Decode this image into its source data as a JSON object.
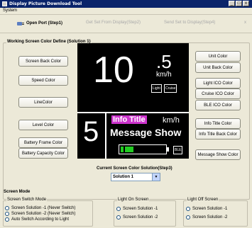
{
  "window": {
    "title": "Display Picture Download Tool",
    "buttons": [
      "_",
      "□",
      "x"
    ]
  },
  "menu": {
    "items": [
      "System"
    ]
  },
  "toolbar": {
    "open_port": "Open Port (Step1)",
    "get_set": "Get Set From Display(Step2)",
    "send_set": "Send Set to Display(Step4)",
    "close": "x"
  },
  "working": {
    "title": "Working Screen Color Define (Solution 1)",
    "left_buttons": [
      "Screen Back Color",
      "Speed Color",
      "LineColor",
      "Level Color",
      "Battery Frame Color",
      "Battery Capacity Color"
    ],
    "right_buttons": [
      "Unit Color",
      "Unit Back Color",
      "Light ICO Color",
      "Cruise ICO Color",
      "BLE ICO Color",
      "Info Title Color",
      "Info Title Back Color",
      "Message Show Color"
    ],
    "current_label": "Current Screen Color Solution(Step3)",
    "current_value": "Solution 1"
  },
  "preview": {
    "speed_int": "10",
    "speed_dec": ".5",
    "unit": "km/h",
    "light_badge": "Light",
    "cruise_badge": "Cruise",
    "level": "5",
    "info_title": "Info Title",
    "unit_small": "km/h",
    "message": "Message Show",
    "ble_badge": "BLE",
    "info_title_bg": "#cc33cc",
    "battery_color": "#22cc22"
  },
  "screen_mode": {
    "title": "Screen Mode",
    "switch_title": "Screen Switch Mode",
    "switch_options": [
      "Screen Solution -1 (Never Switch)",
      "Screen Solution -2 (Never Switch)",
      "Auto Switch According to Light"
    ],
    "light_on_title": "Light On Screen",
    "light_on_options": [
      "Screen Solution -1",
      "Screen Solution -2"
    ],
    "light_off_title": "Light Off Screen",
    "light_off_options": [
      "Screen Solution -1",
      "Screen Solution -2"
    ]
  }
}
